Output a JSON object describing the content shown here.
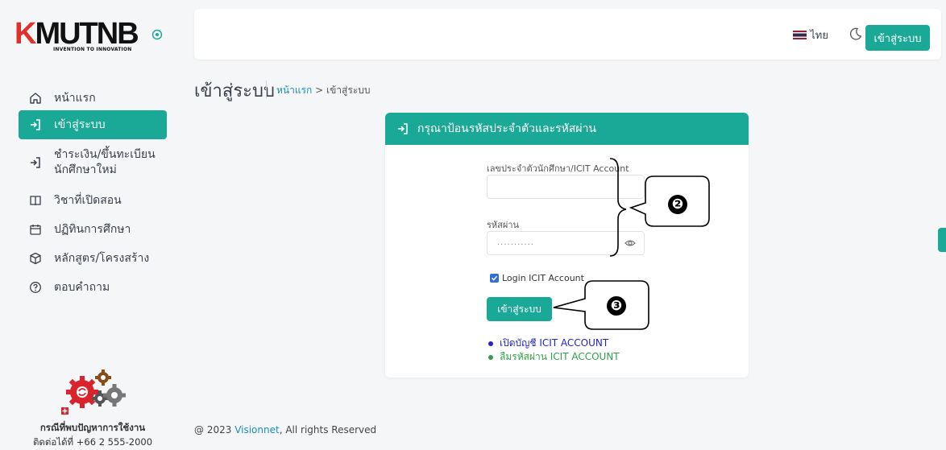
{
  "logo": {
    "text": "KMUTNB",
    "tagline": "INVENTION TO INNOVATION"
  },
  "sidebar": {
    "items": [
      {
        "label": "หน้าแรก",
        "icon": "home-icon"
      },
      {
        "label": "เข้าสู่ระบบ",
        "icon": "login-icon",
        "active": true
      },
      {
        "label": "ชำระเงิน/ขึ้นทะเบียน\nนักศึกษาใหม่",
        "line1": "ชำระเงิน/ขึ้นทะเบียน",
        "line2": "นักศึกษาใหม่",
        "icon": "login-icon"
      },
      {
        "label": "วิชาที่เปิดสอน",
        "icon": "book-icon"
      },
      {
        "label": "ปฏิทินการศึกษา",
        "icon": "calendar-icon"
      },
      {
        "label": "หลักสูตร/โครงสร้าง",
        "icon": "cube-icon"
      },
      {
        "label": "ตอบคำถาม",
        "icon": "question-icon"
      }
    ],
    "help": {
      "title": "กรณีที่พบปัญหาการใช้งาน",
      "phone": "ติดต่อได้ที่ +66 2 555-2000"
    }
  },
  "topbar": {
    "language": "ไทย",
    "login_button": "เข้าสู่ระบบ"
  },
  "page": {
    "title": "เข้าสู่ระบบ",
    "breadcrumb": {
      "home": "หน้าแรก",
      "separator": ">",
      "current": "เข้าสู่ระบบ"
    }
  },
  "login_form": {
    "header": "กรุณาป้อนรหัสประจำตัวและรหัสผ่าน",
    "username_label": "เลขประจำตัวนักศึกษา/ICIT Account",
    "username_value": "",
    "password_label": "รหัสผ่าน",
    "password_masked": "...........",
    "remember_label": "Login ICIT Account",
    "remember_checked": true,
    "submit_label": "เข้าสู่ระบบ",
    "links": [
      {
        "label": "เปิดบัญชี ICIT ACCOUNT",
        "color": "#2323c8"
      },
      {
        "label": "ลืมรหัสผ่าน ICIT ACCOUNT",
        "color": "#2e9e48"
      }
    ]
  },
  "annotations": {
    "callout_2": "❷",
    "callout_3": "❸"
  },
  "footer": {
    "prefix": "@ 2023",
    "brand": "Visionnet",
    "suffix": ", All rights Reserved"
  },
  "colors": {
    "accent": "#1aa996",
    "link_blue": "#1a8fb8"
  }
}
